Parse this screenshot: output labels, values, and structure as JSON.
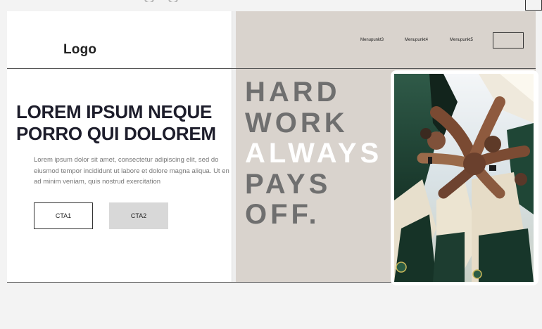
{
  "header": {
    "logo": "Logo",
    "nav_items": [
      "Menupunkt3",
      "Menupunkt4",
      "Menupunkt5"
    ]
  },
  "hero": {
    "headline_lines": [
      "LOREM IPSUM NEQUE",
      "PORRO QUI DOLOREM"
    ],
    "body_lines": [
      "Lorem ipsum dolor sit amet, consectetur adipiscing elit, sed do",
      "eiusmod tempor incididunt ut labore et dolore magna aliqua. Ut en",
      "ad minim veniam, quis nostrud exercitation"
    ],
    "cta1": "CTA1",
    "cta2": "CTA2"
  },
  "slogan": {
    "lines": [
      "HARD",
      "WORK",
      "ALWAYS",
      "PAYS",
      "OFF."
    ]
  },
  "colors": {
    "right_panel_bg": "#d9d3cd",
    "headline": "#1d1d2b",
    "slogan_grey": "#6f6f6f",
    "slogan_highlight": "#ffffff",
    "cta2_bg": "#d8d8d8"
  },
  "image": {
    "subject": "team-huddle-photo"
  }
}
